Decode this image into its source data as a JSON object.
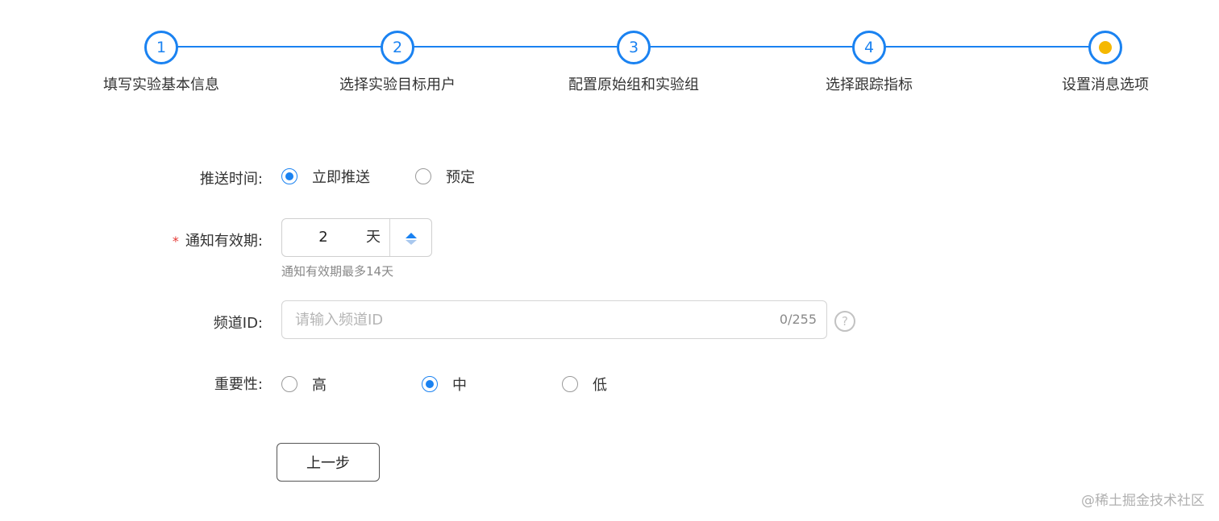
{
  "steps": [
    {
      "number": "1",
      "label": "填写实验基本信息"
    },
    {
      "number": "2",
      "label": "选择实验目标用户"
    },
    {
      "number": "3",
      "label": "配置原始组和实验组"
    },
    {
      "number": "4",
      "label": "选择跟踪指标"
    },
    {
      "number": "",
      "label": "设置消息选项"
    }
  ],
  "form": {
    "push_time": {
      "label": "推送时间:",
      "options": [
        "立即推送",
        "预定"
      ],
      "selected": "立即推送"
    },
    "validity": {
      "required_mark": "*",
      "label": "通知有效期:",
      "value": "2",
      "unit": "天",
      "hint": "通知有效期最多14天"
    },
    "channel_id": {
      "label": "频道ID:",
      "placeholder": "请输入频道ID",
      "value": "",
      "counter": "0/255",
      "help_icon": "question-circle-icon"
    },
    "importance": {
      "label": "重要性:",
      "options": [
        "高",
        "中",
        "低"
      ],
      "selected": "中"
    }
  },
  "buttons": {
    "prev": "上一步"
  },
  "watermark": "@稀土掘金技术社区",
  "colors": {
    "primary": "#1a82f1",
    "current_step_dot": "#f5b800",
    "required": "#e53935"
  }
}
